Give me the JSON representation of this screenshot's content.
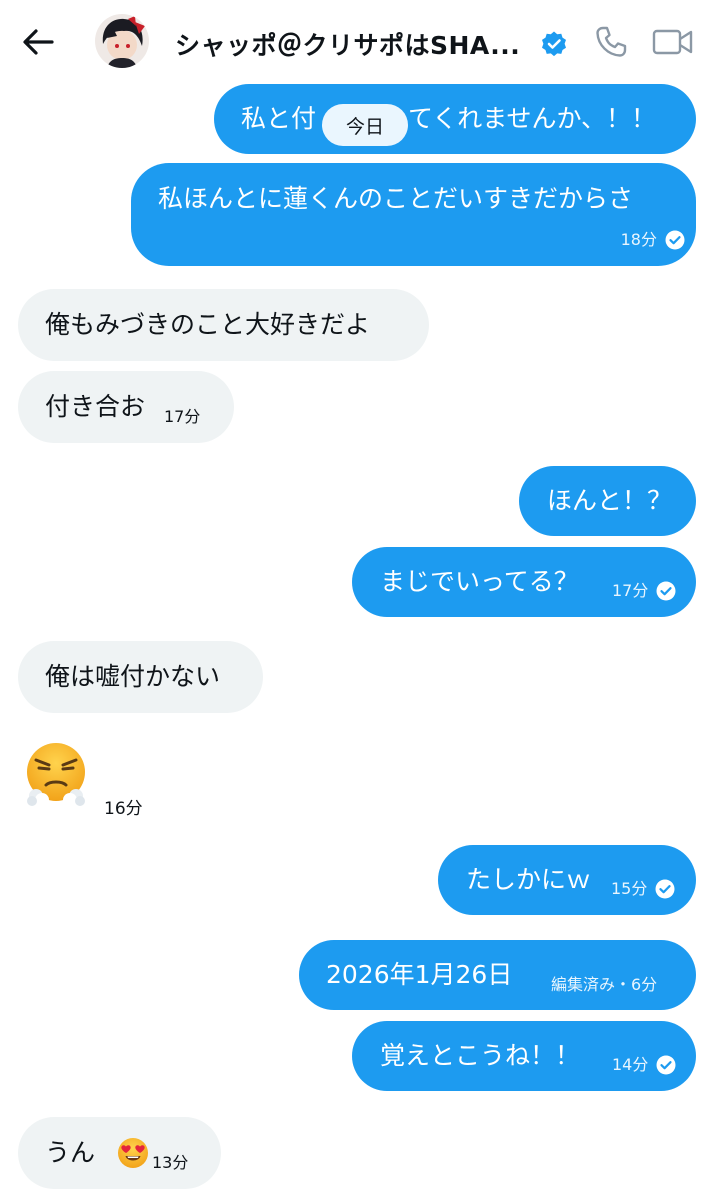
{
  "header": {
    "contact_name": "シャッポ＠クリサポはSHA...",
    "back_icon": "arrow-left-icon",
    "verified_icon": "verified-badge-icon",
    "call_icon": "phone-icon",
    "video_icon": "video-camera-icon"
  },
  "date_separator": "今日",
  "messages": [
    {
      "text_left": "私と付",
      "text_right": "てくれませんか、！！"
    },
    {
      "text": "私ほんとに蓮くんのことだいすきだからさ",
      "time": "18分",
      "read_icon": "read-check-icon"
    },
    {
      "text": "俺もみづきのこと大好きだよ"
    },
    {
      "text": "付き合お",
      "time": "17分"
    },
    {
      "text": "ほんと！？"
    },
    {
      "text": "まじでいってる？",
      "time": "17分",
      "read_icon": "read-check-icon"
    },
    {
      "text": "俺は嘘付かない"
    },
    {
      "emoji": "face-with-steam-from-nose",
      "time": "16分"
    },
    {
      "text": "たしかにｗ",
      "time": "15分",
      "read_icon": "read-check-icon"
    },
    {
      "text": "2026年1月26日",
      "edited_label": "編集済み・6分"
    },
    {
      "text": "覚えとこうね！！",
      "time": "14分",
      "read_icon": "read-check-icon"
    },
    {
      "text": "うん",
      "emoji": "smiling-face-with-heart-eyes",
      "time": "13分"
    }
  ],
  "colors": {
    "outgoing_bubble": "#1d9bf0",
    "incoming_bubble": "#eff3f4",
    "verified_badge": "#1d9bf0"
  }
}
